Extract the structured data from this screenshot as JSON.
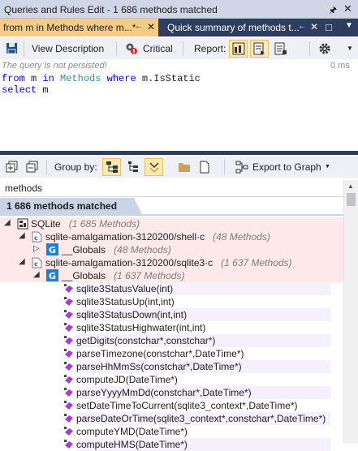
{
  "window": {
    "title": "Queries and Rules Edit  - 1 686 methods matched"
  },
  "tabs": [
    {
      "label": "from m in Methods where m...*"
    },
    {
      "label": "Quick summary of methods t..."
    }
  ],
  "toolbar1": {
    "view_description": "View Description",
    "critical": "Critical",
    "report": "Report:"
  },
  "editor": {
    "warning": "The query is not persisted!",
    "time": "0 ms",
    "line1": {
      "from": "from",
      "m1": " m ",
      "in": "in",
      "methods": "Methods",
      "where": "where",
      "cond": " m.IsStatic"
    },
    "line2": {
      "select": "select",
      "m": " m"
    }
  },
  "toolbar2": {
    "group_by": "Group by:",
    "export": "Export to Graph"
  },
  "search": {
    "value": "methods"
  },
  "results": {
    "summary": "1 686 methods matched"
  },
  "tree": [
    {
      "label": "SQLite",
      "count": "(1 685 Methods)"
    },
    {
      "label": "sqlite-amalgamation-3120200/shell·c",
      "count": "(48 Methods)"
    },
    {
      "label": "__Globals",
      "count": "(48 Methods)"
    },
    {
      "label": "sqlite-amalgamation-3120200/sqlite3·c",
      "count": "(1 637 Methods)"
    },
    {
      "label": "__Globals",
      "count": "(1 637 Methods)"
    }
  ],
  "methods": [
    "sqlite3StatusValue(int)",
    "sqlite3StatusUp(int,int)",
    "sqlite3StatusDown(int,int)",
    "sqlite3StatusHighwater(int,int)",
    "getDigits(constchar*,constchar*)",
    "parseTimezone(constchar*,DateTime*)",
    "parseHhMmSs(constchar*,DateTime*)",
    "computeJD(DateTime*)",
    "parseYyyyMmDd(constchar*,DateTime*)",
    "setDateTimeToCurrent(sqlite3_context*,DateTime*)",
    "parseDateOrTime(sqlite3_context*,constchar*,DateTime*)",
    "computeYMD(DateTime*)",
    "computeHMS(DateTime*)"
  ],
  "colors": {
    "accent_tab": "#f5cc84",
    "tab_strip": "#2d3e5e",
    "title_bar": "#cfd6e5",
    "pink_row": "#fde9e9",
    "method_icon": "#a83bd8"
  },
  "icons": [
    "pin-icon",
    "close-icon",
    "save-icon",
    "critical-icon",
    "report-icon",
    "gear-icon",
    "expand-icon",
    "folder-icon",
    "page-icon",
    "export-graph-icon",
    "sqlite-icon",
    "c-file-icon",
    "globals-icon",
    "method-icon"
  ]
}
